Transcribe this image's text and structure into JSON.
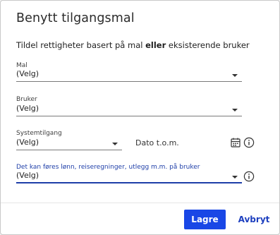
{
  "dialog": {
    "title": "Benytt tilgangsmal",
    "subtitle_prefix": "Tildel rettigheter basert på mal ",
    "subtitle_bold": "eller",
    "subtitle_suffix": " eksisterende bruker"
  },
  "fields": {
    "mal": {
      "label": "Mal",
      "value": "(Velg)"
    },
    "bruker": {
      "label": "Bruker",
      "value": "(Velg)"
    },
    "systemtilgang": {
      "label": "Systemtilgang",
      "value": "(Velg)"
    },
    "dato": {
      "label": "Dato t.o.m."
    },
    "lonn": {
      "label": "Det kan føres lønn, reiseregninger, utlegg m.m. på bruker",
      "value": "(Velg)"
    }
  },
  "icons": {
    "calendar": "calendar-icon",
    "info": "info-icon",
    "caret": "chevron-down-icon"
  },
  "buttons": {
    "save": "Lagre",
    "cancel": "Avbryt"
  },
  "colors": {
    "primary": "#1947e6",
    "link": "#1d3fbf",
    "active_label": "#1e3ea8"
  }
}
